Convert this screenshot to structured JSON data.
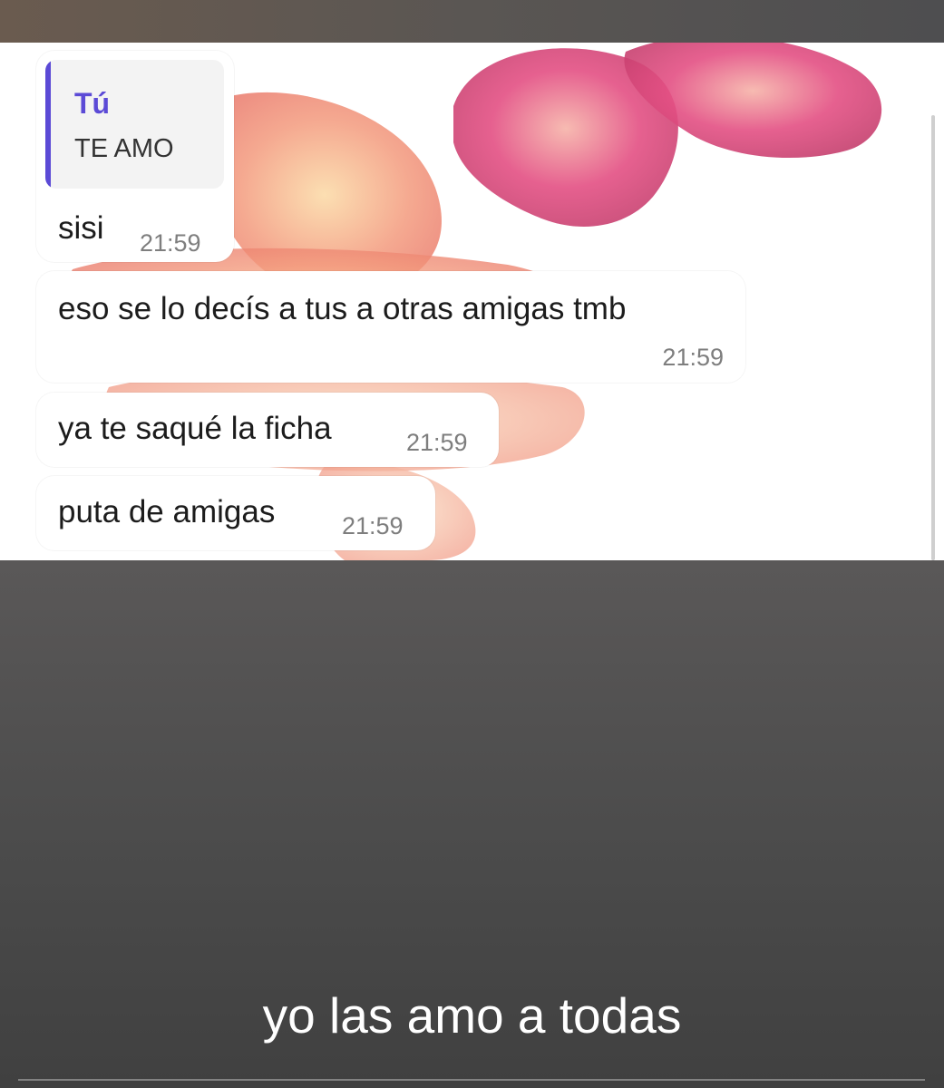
{
  "quoted_reply": {
    "author": "Tú",
    "text": "TE AMO"
  },
  "messages": [
    {
      "text": "sisi",
      "time": "21:59"
    },
    {
      "text": "eso se lo decís a tus a otras amigas tmb",
      "time": "21:59"
    },
    {
      "text": "ya te saqué la ficha",
      "time": "21:59"
    },
    {
      "text": "puta de amigas",
      "time": "21:59"
    }
  ],
  "caption": "yo las amo a todas",
  "colors": {
    "accent": "#5b4ad6",
    "bubble": "#ffffff",
    "timestamp": "#7e7e7e"
  }
}
